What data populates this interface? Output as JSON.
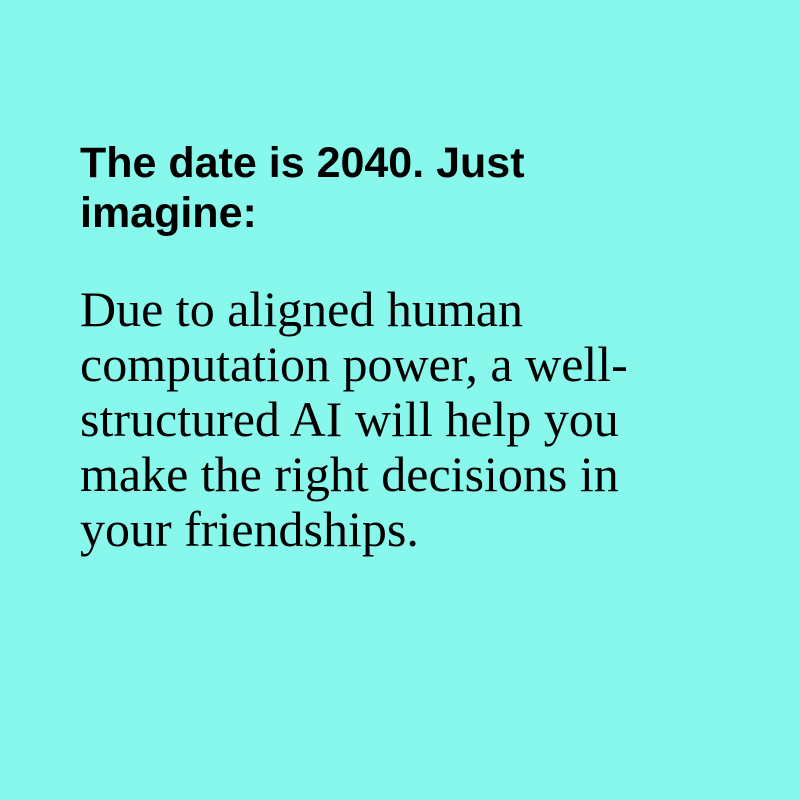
{
  "card": {
    "background_color": "#89f8ec",
    "text_color": "#000000",
    "headline": "The date is 2040. Just imagine:",
    "body": "Due to aligned human computation power, a well-structured AI will help you make the right decisions in your friendships."
  }
}
